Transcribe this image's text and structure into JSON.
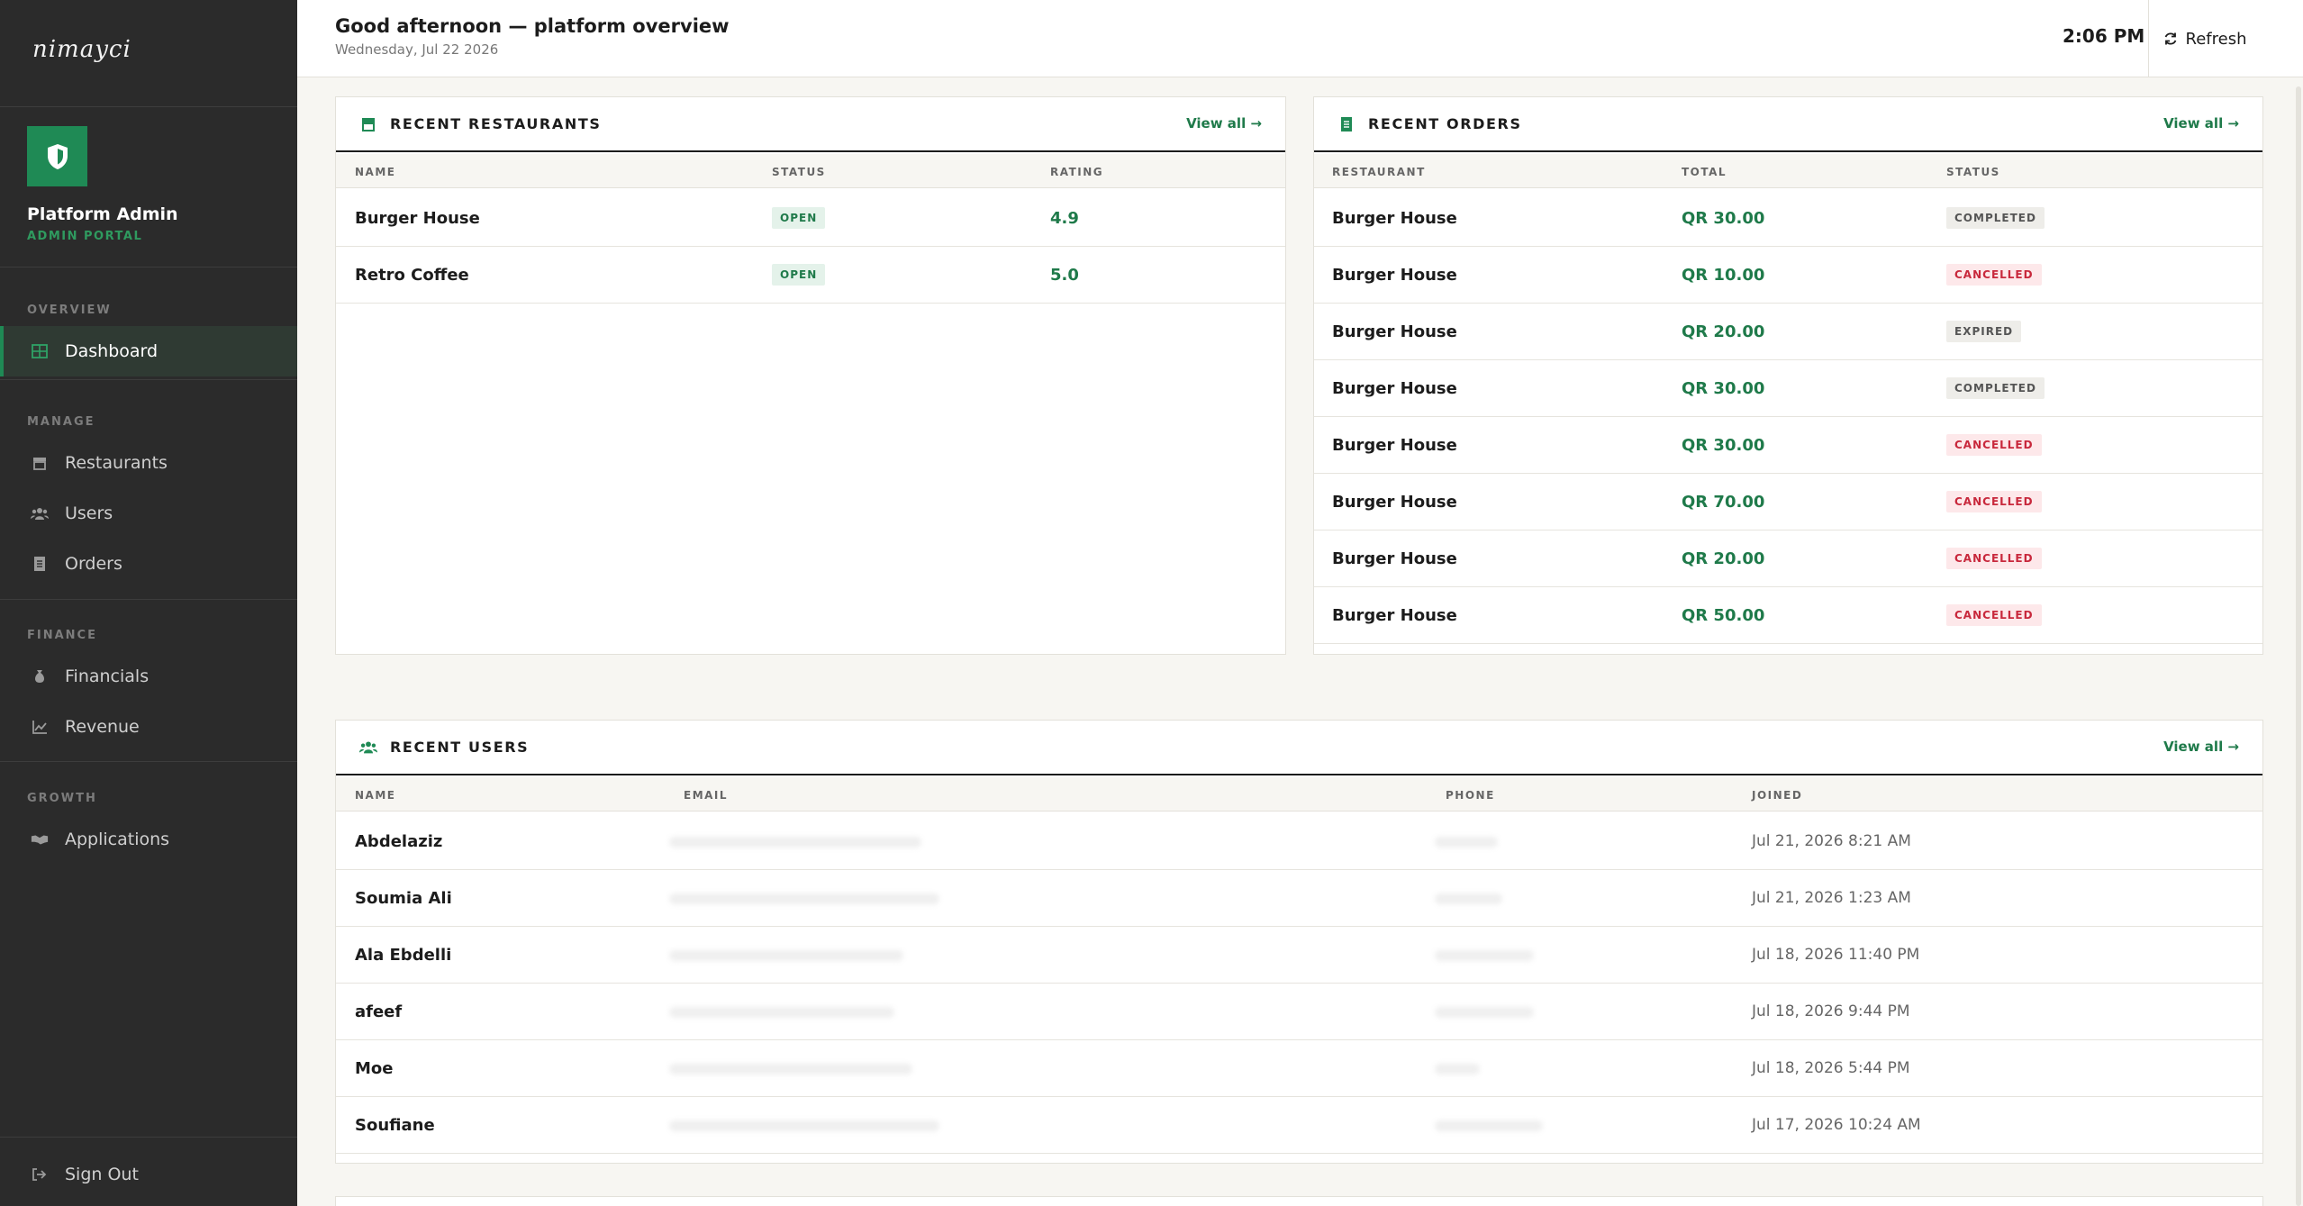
{
  "sidebar": {
    "logo": "nimayci",
    "brand_name": "Platform Admin",
    "brand_sub": "ADMIN PORTAL",
    "sections": {
      "overview": "OVERVIEW",
      "manage": "MANAGE",
      "finance": "FINANCE",
      "growth": "GROWTH"
    },
    "items": {
      "dashboard": "Dashboard",
      "restaurants": "Restaurants",
      "users": "Users",
      "orders": "Orders",
      "financials": "Financials",
      "revenue": "Revenue",
      "applications": "Applications"
    },
    "sign_out": "Sign Out"
  },
  "topbar": {
    "greeting": "Good afternoon — platform overview",
    "date": "Wednesday, Jul 22 2026",
    "time": "2:06 PM",
    "refresh": "Refresh"
  },
  "restaurants": {
    "title": "RECENT RESTAURANTS",
    "view_all": "View all →",
    "columns": [
      "NAME",
      "STATUS",
      "RATING"
    ],
    "rows": [
      {
        "name": "Burger House",
        "status": "OPEN",
        "rating": "4.9"
      },
      {
        "name": "Retro Coffee",
        "status": "OPEN",
        "rating": "5.0"
      }
    ]
  },
  "orders": {
    "title": "RECENT ORDERS",
    "view_all": "View all →",
    "columns": [
      "RESTAURANT",
      "TOTAL",
      "STATUS"
    ],
    "rows": [
      {
        "restaurant": "Burger House",
        "total": "QR 30.00",
        "status": "COMPLETED"
      },
      {
        "restaurant": "Burger House",
        "total": "QR 10.00",
        "status": "CANCELLED"
      },
      {
        "restaurant": "Burger House",
        "total": "QR 20.00",
        "status": "EXPIRED"
      },
      {
        "restaurant": "Burger House",
        "total": "QR 30.00",
        "status": "COMPLETED"
      },
      {
        "restaurant": "Burger House",
        "total": "QR 30.00",
        "status": "CANCELLED"
      },
      {
        "restaurant": "Burger House",
        "total": "QR 70.00",
        "status": "CANCELLED"
      },
      {
        "restaurant": "Burger House",
        "total": "QR 20.00",
        "status": "CANCELLED"
      },
      {
        "restaurant": "Burger House",
        "total": "QR 50.00",
        "status": "CANCELLED"
      }
    ]
  },
  "users": {
    "title": "RECENT USERS",
    "view_all": "View all →",
    "columns": [
      "NAME",
      "EMAIL",
      "PHONE",
      "JOINED"
    ],
    "rows": [
      {
        "name": "Abdelaziz",
        "joined": "Jul 21, 2026 8:21 AM"
      },
      {
        "name": "Soumia Ali",
        "joined": "Jul 21, 2026 1:23 AM"
      },
      {
        "name": "Ala Ebdelli",
        "joined": "Jul 18, 2026 11:40 PM"
      },
      {
        "name": "afeef",
        "joined": "Jul 18, 2026 9:44 PM"
      },
      {
        "name": "Moe",
        "joined": "Jul 18, 2026 5:44 PM"
      },
      {
        "name": "Soufiane",
        "joined": "Jul 17, 2026 10:24 AM"
      }
    ]
  }
}
